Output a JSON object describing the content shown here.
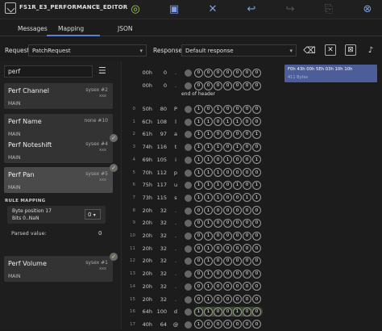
{
  "app": {
    "title": "FS1R_E3_PERFORMANCE_EDITOR"
  },
  "toolbar": {
    "icons": [
      "play-icon",
      "save-icon",
      "tools-icon",
      "undo-icon",
      "redo-icon",
      "copy-icon",
      "close-icon"
    ]
  },
  "tabs": [
    "Messages",
    "Mapping",
    "JSON"
  ],
  "request": {
    "label": "Request",
    "value": "PatchRequest"
  },
  "response": {
    "label": "Response",
    "value": "Default response"
  },
  "search": {
    "value": "perf"
  },
  "cards": [
    {
      "name": "Perf Channel",
      "tag": "sysex #2",
      "sub": "xxx",
      "group": "MAIN",
      "checked": false
    },
    {
      "name": "Perf Name",
      "tag": "none #10",
      "sub": "",
      "group": "MAIN",
      "checked": false
    },
    {
      "name": "Perf Noteshift",
      "tag": "sysex #4",
      "sub": "xxx",
      "group": "MAIN",
      "checked": true
    },
    {
      "name": "Perf Pan",
      "tag": "sysex #5",
      "sub": "xxx",
      "group": "MAIN",
      "checked": true
    },
    {
      "name": "Perf Volume",
      "tag": "sysex #1",
      "sub": "xxx",
      "group": "MAIN",
      "checked": true
    }
  ],
  "rule_mapping": {
    "title": "RULE MAPPING",
    "line1": "Byte position 17",
    "line2": "Bits 0..NaN",
    "select_value": "0",
    "parsed_label": "Parsed value:",
    "parsed_value": "0"
  },
  "end_of_header": "end of header",
  "rows_top": [
    {
      "idx": "",
      "hex": "00h",
      "dec": "0",
      "chr": ".",
      "bits": [
        "0",
        "0",
        "0",
        "0",
        "0",
        "0",
        "0"
      ]
    },
    {
      "idx": "",
      "hex": "00h",
      "dec": "0",
      "chr": ".",
      "bits": [
        "0",
        "0",
        "0",
        "0",
        "0",
        "0",
        "0"
      ]
    }
  ],
  "rows": [
    {
      "idx": "0",
      "hex": "50h",
      "dec": "80",
      "chr": "P",
      "bits": [
        "1",
        "0",
        "1",
        "0",
        "0",
        "0",
        "0"
      ]
    },
    {
      "idx": "1",
      "hex": "6Ch",
      "dec": "108",
      "chr": "l",
      "bits": [
        "1",
        "1",
        "0",
        "1",
        "1",
        "0",
        "0"
      ]
    },
    {
      "idx": "2",
      "hex": "61h",
      "dec": "97",
      "chr": "a",
      "bits": [
        "1",
        "1",
        "0",
        "0",
        "0",
        "0",
        "1"
      ]
    },
    {
      "idx": "3",
      "hex": "74h",
      "dec": "116",
      "chr": "t",
      "bits": [
        "1",
        "1",
        "1",
        "0",
        "1",
        "0",
        "0"
      ]
    },
    {
      "idx": "4",
      "hex": "69h",
      "dec": "105",
      "chr": "i",
      "bits": [
        "1",
        "1",
        "0",
        "1",
        "0",
        "0",
        "1"
      ]
    },
    {
      "idx": "5",
      "hex": "70h",
      "dec": "112",
      "chr": "p",
      "bits": [
        "1",
        "1",
        "1",
        "0",
        "0",
        "0",
        "0"
      ]
    },
    {
      "idx": "6",
      "hex": "75h",
      "dec": "117",
      "chr": "u",
      "bits": [
        "1",
        "1",
        "1",
        "0",
        "1",
        "0",
        "1"
      ]
    },
    {
      "idx": "7",
      "hex": "73h",
      "dec": "115",
      "chr": "s",
      "bits": [
        "1",
        "1",
        "1",
        "0",
        "0",
        "1",
        "1"
      ]
    },
    {
      "idx": "8",
      "hex": "20h",
      "dec": "32",
      "chr": ".",
      "bits": [
        "0",
        "1",
        "0",
        "0",
        "0",
        "0",
        "0"
      ]
    },
    {
      "idx": "9",
      "hex": "20h",
      "dec": "32",
      "chr": ".",
      "bits": [
        "0",
        "1",
        "0",
        "0",
        "0",
        "0",
        "0"
      ]
    },
    {
      "idx": "10",
      "hex": "20h",
      "dec": "32",
      "chr": ".",
      "bits": [
        "0",
        "1",
        "0",
        "0",
        "0",
        "0",
        "0"
      ]
    },
    {
      "idx": "11",
      "hex": "20h",
      "dec": "32",
      "chr": ".",
      "bits": [
        "0",
        "1",
        "0",
        "0",
        "0",
        "0",
        "0"
      ]
    },
    {
      "idx": "12",
      "hex": "20h",
      "dec": "32",
      "chr": ".",
      "bits": [
        "0",
        "1",
        "0",
        "0",
        "0",
        "0",
        "0"
      ]
    },
    {
      "idx": "13",
      "hex": "20h",
      "dec": "32",
      "chr": ".",
      "bits": [
        "0",
        "1",
        "0",
        "0",
        "0",
        "0",
        "0"
      ]
    },
    {
      "idx": "14",
      "hex": "20h",
      "dec": "32",
      "chr": ".",
      "bits": [
        "0",
        "1",
        "0",
        "0",
        "0",
        "0",
        "0"
      ]
    },
    {
      "idx": "15",
      "hex": "20h",
      "dec": "32",
      "chr": ".",
      "bits": [
        "0",
        "1",
        "0",
        "0",
        "0",
        "0",
        "0"
      ]
    },
    {
      "idx": "16",
      "hex": "64h",
      "dec": "100",
      "chr": "d",
      "bits": [
        "1",
        "1",
        "0",
        "0",
        "1",
        "0",
        "0"
      ],
      "highlight": true
    },
    {
      "idx": "17",
      "hex": "40h",
      "dec": "64",
      "chr": "@",
      "bits": [
        "1",
        "0",
        "0",
        "0",
        "0",
        "0",
        "0"
      ]
    }
  ],
  "response_panel": {
    "hex": "F0h 43h 00h 5Eh 03h 10h 10h",
    "size": "411 Bytes"
  },
  "colors": {
    "accent": "#5a7fd6",
    "play": "#9fd14d",
    "check": "#cfe08a",
    "response_bg": "#4d5d9a"
  }
}
